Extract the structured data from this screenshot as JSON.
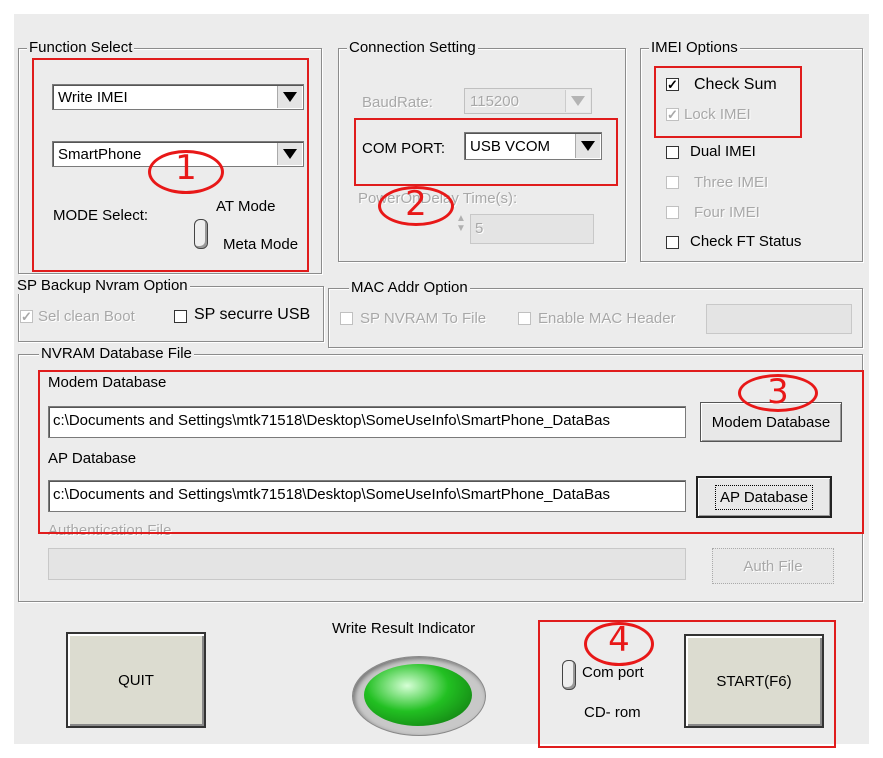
{
  "function_select": {
    "title": "Function Select",
    "function_value": "Write IMEI",
    "phone_value": "SmartPhone",
    "mode_label": "MODE Select:",
    "mode_at": "AT Mode",
    "mode_meta": "Meta Mode",
    "marker": "1"
  },
  "connection": {
    "title": "Connection Setting",
    "baud_label": "BaudRate:",
    "baud_value": "115200",
    "com_label": "COM PORT:",
    "com_value": "USB VCOM",
    "power_label": "PowerOnDelay Time(s):",
    "power_value": "5",
    "marker": "2"
  },
  "imei_options": {
    "title": "IMEI Options",
    "check_sum": "Check Sum",
    "lock_imei": "Lock IMEI",
    "dual_imei": "Dual IMEI",
    "three_imei": "Three IMEI",
    "four_imei": "Four IMEI",
    "check_ft": "Check FT Status"
  },
  "sp_backup": {
    "title": "SP Backup Nvram Option",
    "sel_clean": "Sel clean Boot",
    "sp_secure": "SP securre USB"
  },
  "mac_addr": {
    "title": "MAC Addr Option",
    "sp_nvram": "SP NVRAM To File",
    "enable_mac": "Enable MAC Header",
    "header_value": ""
  },
  "nvram": {
    "title": "NVRAM Database File",
    "modem_label": "Modem Database",
    "modem_path": "c:\\Documents and Settings\\mtk71518\\Desktop\\SomeUseInfo\\SmartPhone_DataBas",
    "modem_button": "Modem Database",
    "ap_label": "AP Database",
    "ap_path": "c:\\Documents and Settings\\mtk71518\\Desktop\\SomeUseInfo\\SmartPhone_DataBas",
    "ap_button": "AP Database",
    "auth_label": "Authentication File",
    "auth_path": "",
    "auth_button": "Auth File",
    "marker": "3"
  },
  "bottom": {
    "quit": "QUIT",
    "indicator_label": "Write Result Indicator",
    "indicator_color": "#22c022",
    "com_port": "Com port",
    "cd_rom": "CD- rom",
    "start": "START(F6)",
    "marker": "4"
  }
}
